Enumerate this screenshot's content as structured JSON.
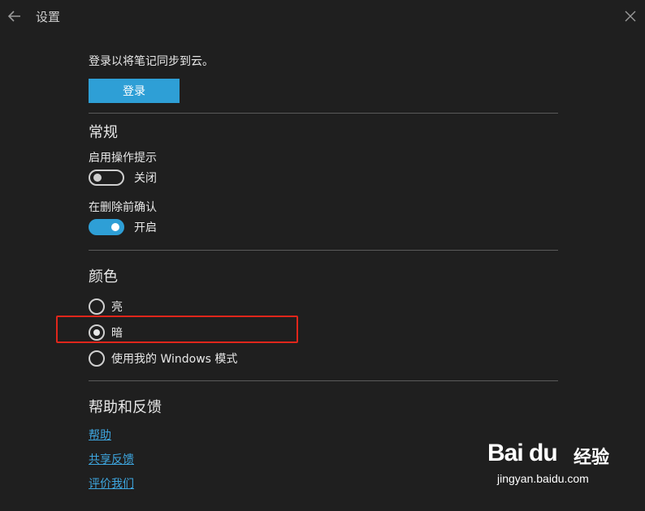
{
  "window": {
    "title": "设置",
    "back_icon": "arrow-left-icon",
    "close_icon": "close-icon"
  },
  "account": {
    "prompt": "登录以将笔记同步到云。",
    "signin_label": "登录"
  },
  "general": {
    "title": "常规",
    "tips_label": "启用操作提示",
    "tips_state": "关闭",
    "tips_on": false,
    "confirm_label": "在删除前确认",
    "confirm_state": "开启",
    "confirm_on": true
  },
  "color": {
    "title": "颜色",
    "options": [
      "亮",
      "暗",
      "使用我的 Windows 模式"
    ],
    "selected": "暗"
  },
  "help": {
    "title": "帮助和反馈",
    "links": [
      "帮助",
      "共享反馈",
      "评价我们"
    ]
  },
  "watermark": {
    "brand": "Bai du",
    "suffix": "经验",
    "url": "jingyan.baidu.com"
  },
  "colors": {
    "background": "#1f1f1f",
    "accent": "#2e9fd6",
    "link": "#3ea6df",
    "highlight": "#e0261b"
  }
}
